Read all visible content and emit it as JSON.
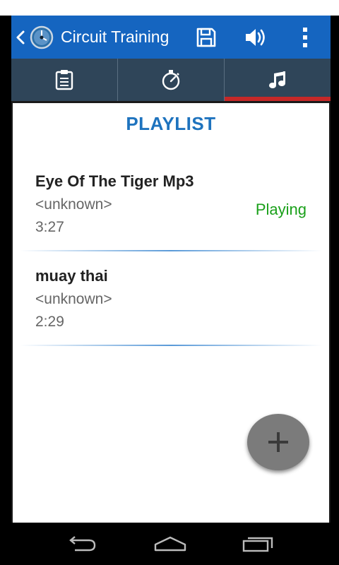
{
  "app": {
    "title": "Circuit Training"
  },
  "actionbar": {
    "back_icon": "chevron-left-icon",
    "logo_icon": "clock-logo-icon",
    "save_icon": "floppy-disk-icon",
    "volume_icon": "speaker-volume-icon",
    "overflow_icon": "more-vertical-icon"
  },
  "tabs": [
    {
      "icon": "clipboard-icon",
      "selected": false
    },
    {
      "icon": "stopwatch-icon",
      "selected": false
    },
    {
      "icon": "music-note-icon",
      "selected": true
    }
  ],
  "playlist": {
    "heading": "PLAYLIST",
    "items": [
      {
        "name": "Eye Of The Tiger Mp3",
        "artist": "<unknown>",
        "duration": "3:27",
        "status": "Playing"
      },
      {
        "name": "muay thai",
        "artist": "<unknown>",
        "duration": "2:29",
        "status": ""
      }
    ]
  },
  "fab": {
    "icon": "plus-icon"
  },
  "colors": {
    "actionbar": "#1565c0",
    "tabbar": "#2f4559",
    "tab_indicator": "#c62828",
    "heading": "#1e73be",
    "playing": "#1aa01a"
  },
  "navbar": {
    "icons": [
      "back-nav-icon",
      "home-nav-icon",
      "recents-nav-icon"
    ]
  }
}
